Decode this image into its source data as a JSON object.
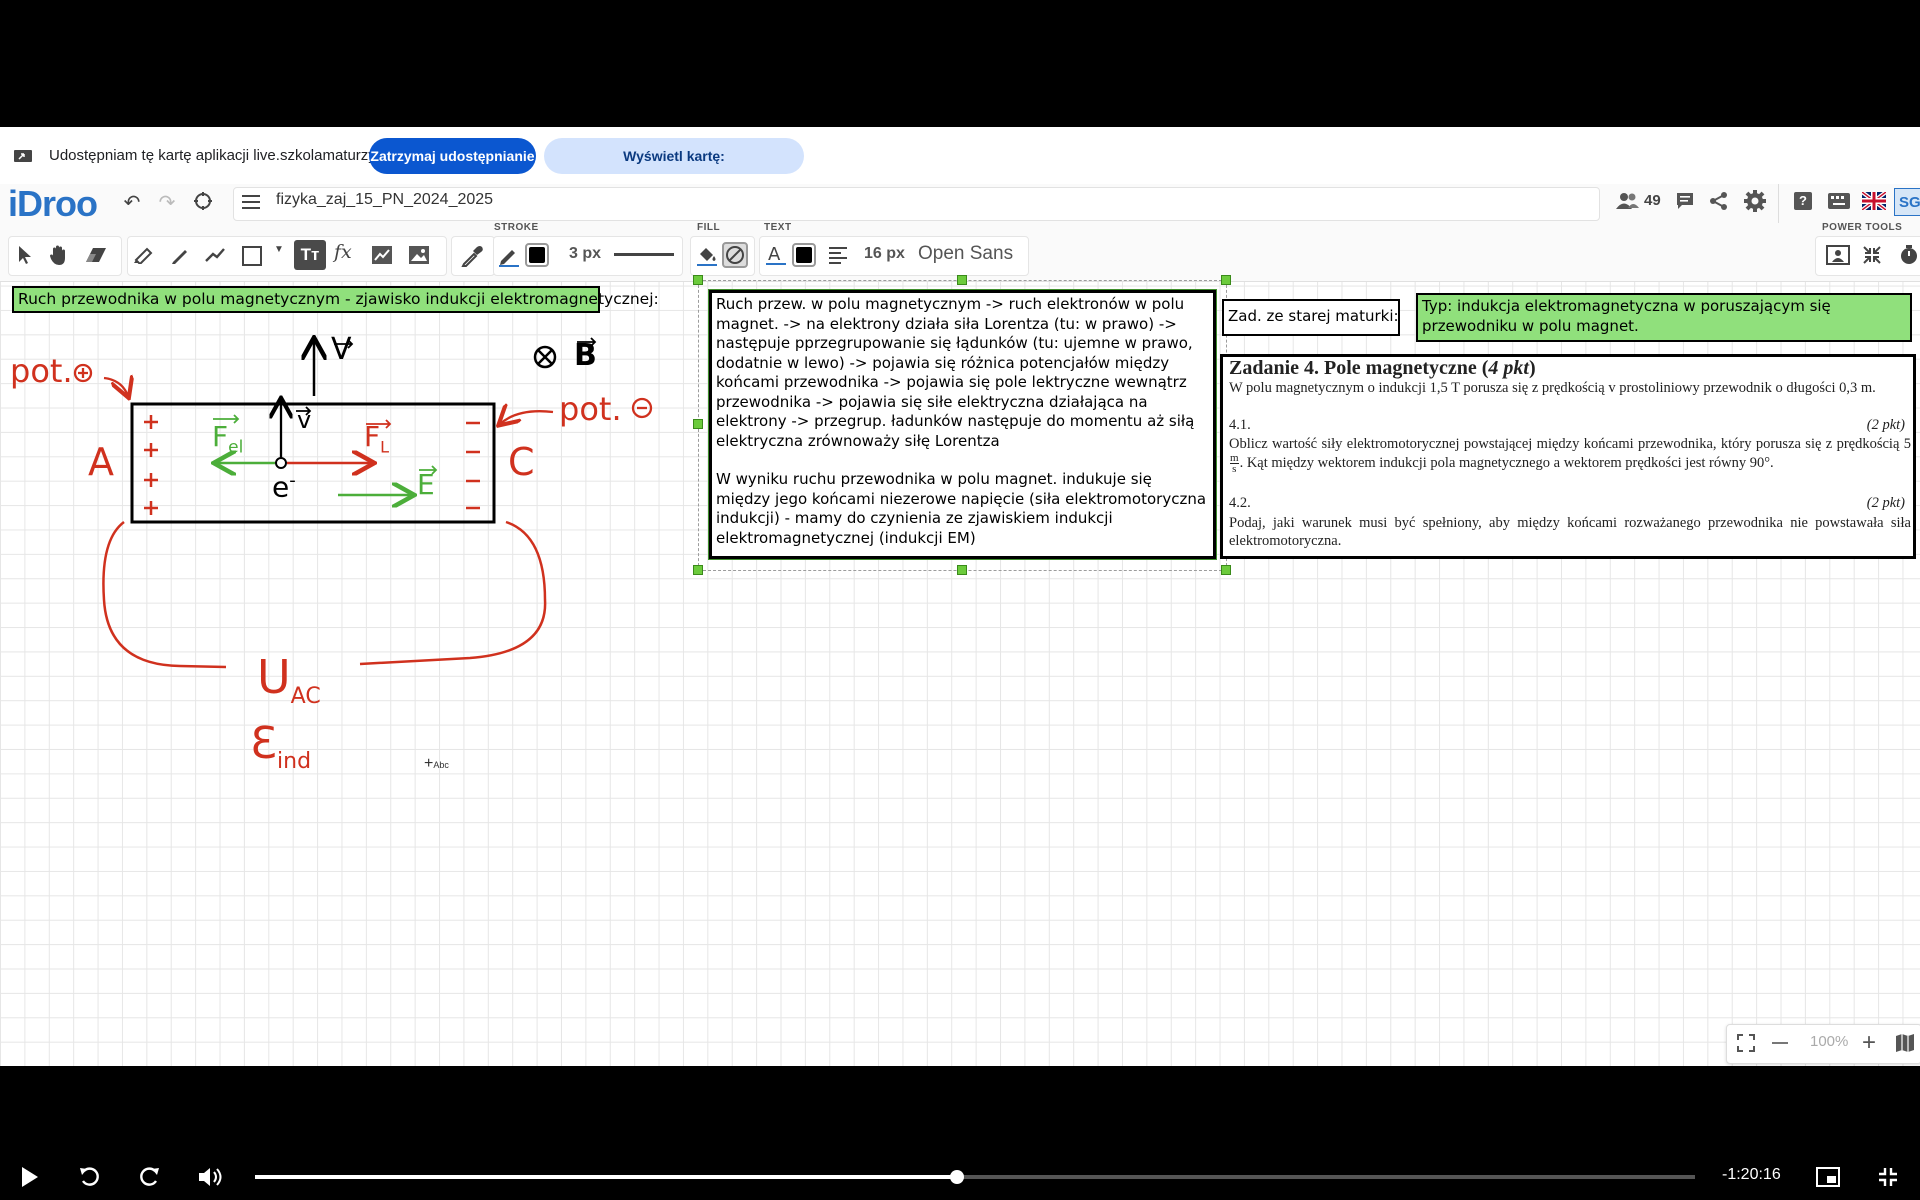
{
  "share_bar": {
    "text": "Udostępniam tę kartę aplikacji live.szkolamaturzystow.pl",
    "stop_label": "Zatrzymaj udostępnianie",
    "view_label": "Wyświetl kartę: live.szkolamaturzystow.pl"
  },
  "app": {
    "logo": "iDroo",
    "board_title": "fizyka_zaj_15_PN_2024_2025",
    "user_count": "49",
    "user_initials": "SG"
  },
  "toolbar": {
    "stroke_label": "STROKE",
    "fill_label": "FILL",
    "text_label": "TEXT",
    "stroke_width": "3 px",
    "font_size": "16 px",
    "font_name": "Open Sans",
    "power_tools_label": "POWER TOOLS",
    "stroke_color": "#000000",
    "text_color": "#000000"
  },
  "canvas": {
    "heading": "Ruch przewodnika w polu magnetycznym - zjawisko indukcji elektromagnetycznej:",
    "drawing": {
      "label_v": "V",
      "label_b": "B",
      "label_pot_plus": "pot.",
      "label_pot_minus": "pot.",
      "label_A": "A",
      "label_C": "C",
      "label_v2": "v",
      "label_fel": "F",
      "label_fel_sub": "el",
      "label_fl": "F",
      "label_fl_sub": "L",
      "label_e": "e",
      "label_E": "E",
      "label_uac": "U",
      "label_uac_sub": "AC",
      "label_eind": "Ɛ",
      "label_eind_sub": "ind"
    },
    "note1_p1": "Ruch przew. w polu magnetycznym -> ruch elektronów w polu magnet. -> na elektrony działa siła Lorentza (tu: w prawo) -> następuje pprzegrupowanie się łądunków (tu: ujemne w prawo, dodatnie w lewo) -> pojawia się różnica potencjałów między końcami przewodnika -> pojawia się pole lektryczne wewnątrz przewodnika -> pojawia się siłe elektryczna działająca na elektrony -> przegrup. ładunków następuje do momentu aż siłą elektryczna zrównoważy siłę Lorentza",
    "note1_p2": "W wyniku ruchu przewodnika w polu magnet. indukuje się między jego końcami niezerowe napięcie (siła elektromotoryczna indukcji) - mamy do czynienia ze zjawiskiem indukcji elektromagnetycznej (indukcji EM)",
    "note_old_exam": "Zad. ze starej maturki:",
    "note_type": "Typ: indukcja elektromagnetyczna w poruszającym się przewodniku w polu magnet.",
    "task": {
      "title": "Zadanie 4. Pole magnetyczne (",
      "title_pts": "4 pkt",
      "title_end": ")",
      "intro": "W polu magnetycznym o indukcji 1,5 T porusza się z prędkością v prostoliniowy przewodnik o długości 0,3 m.",
      "q1_num": "4.1.",
      "q1_pts": "(2 pkt)",
      "q1_text_a": "Oblicz wartość siły elektromotorycznej powstającej między końcami przewodnika, który porusza się z prędkością 5",
      "q1_unit_top": "m",
      "q1_unit_bot": "s",
      "q1_text_b": ". Kąt między wektorem indukcji pola magnetycznego a wektorem prędkości jest równy 90°.",
      "q2_num": "4.2.",
      "q2_pts": "(2 pkt)",
      "q2_text": "Podaj, jaki warunek musi być spełniony, aby między końcami rozważanego przewodnika nie powstawała siła elektromotoryczna."
    }
  },
  "zoom": {
    "level": "100%"
  },
  "player": {
    "time_remaining": "-1:20:16",
    "progress": 0.4875
  }
}
